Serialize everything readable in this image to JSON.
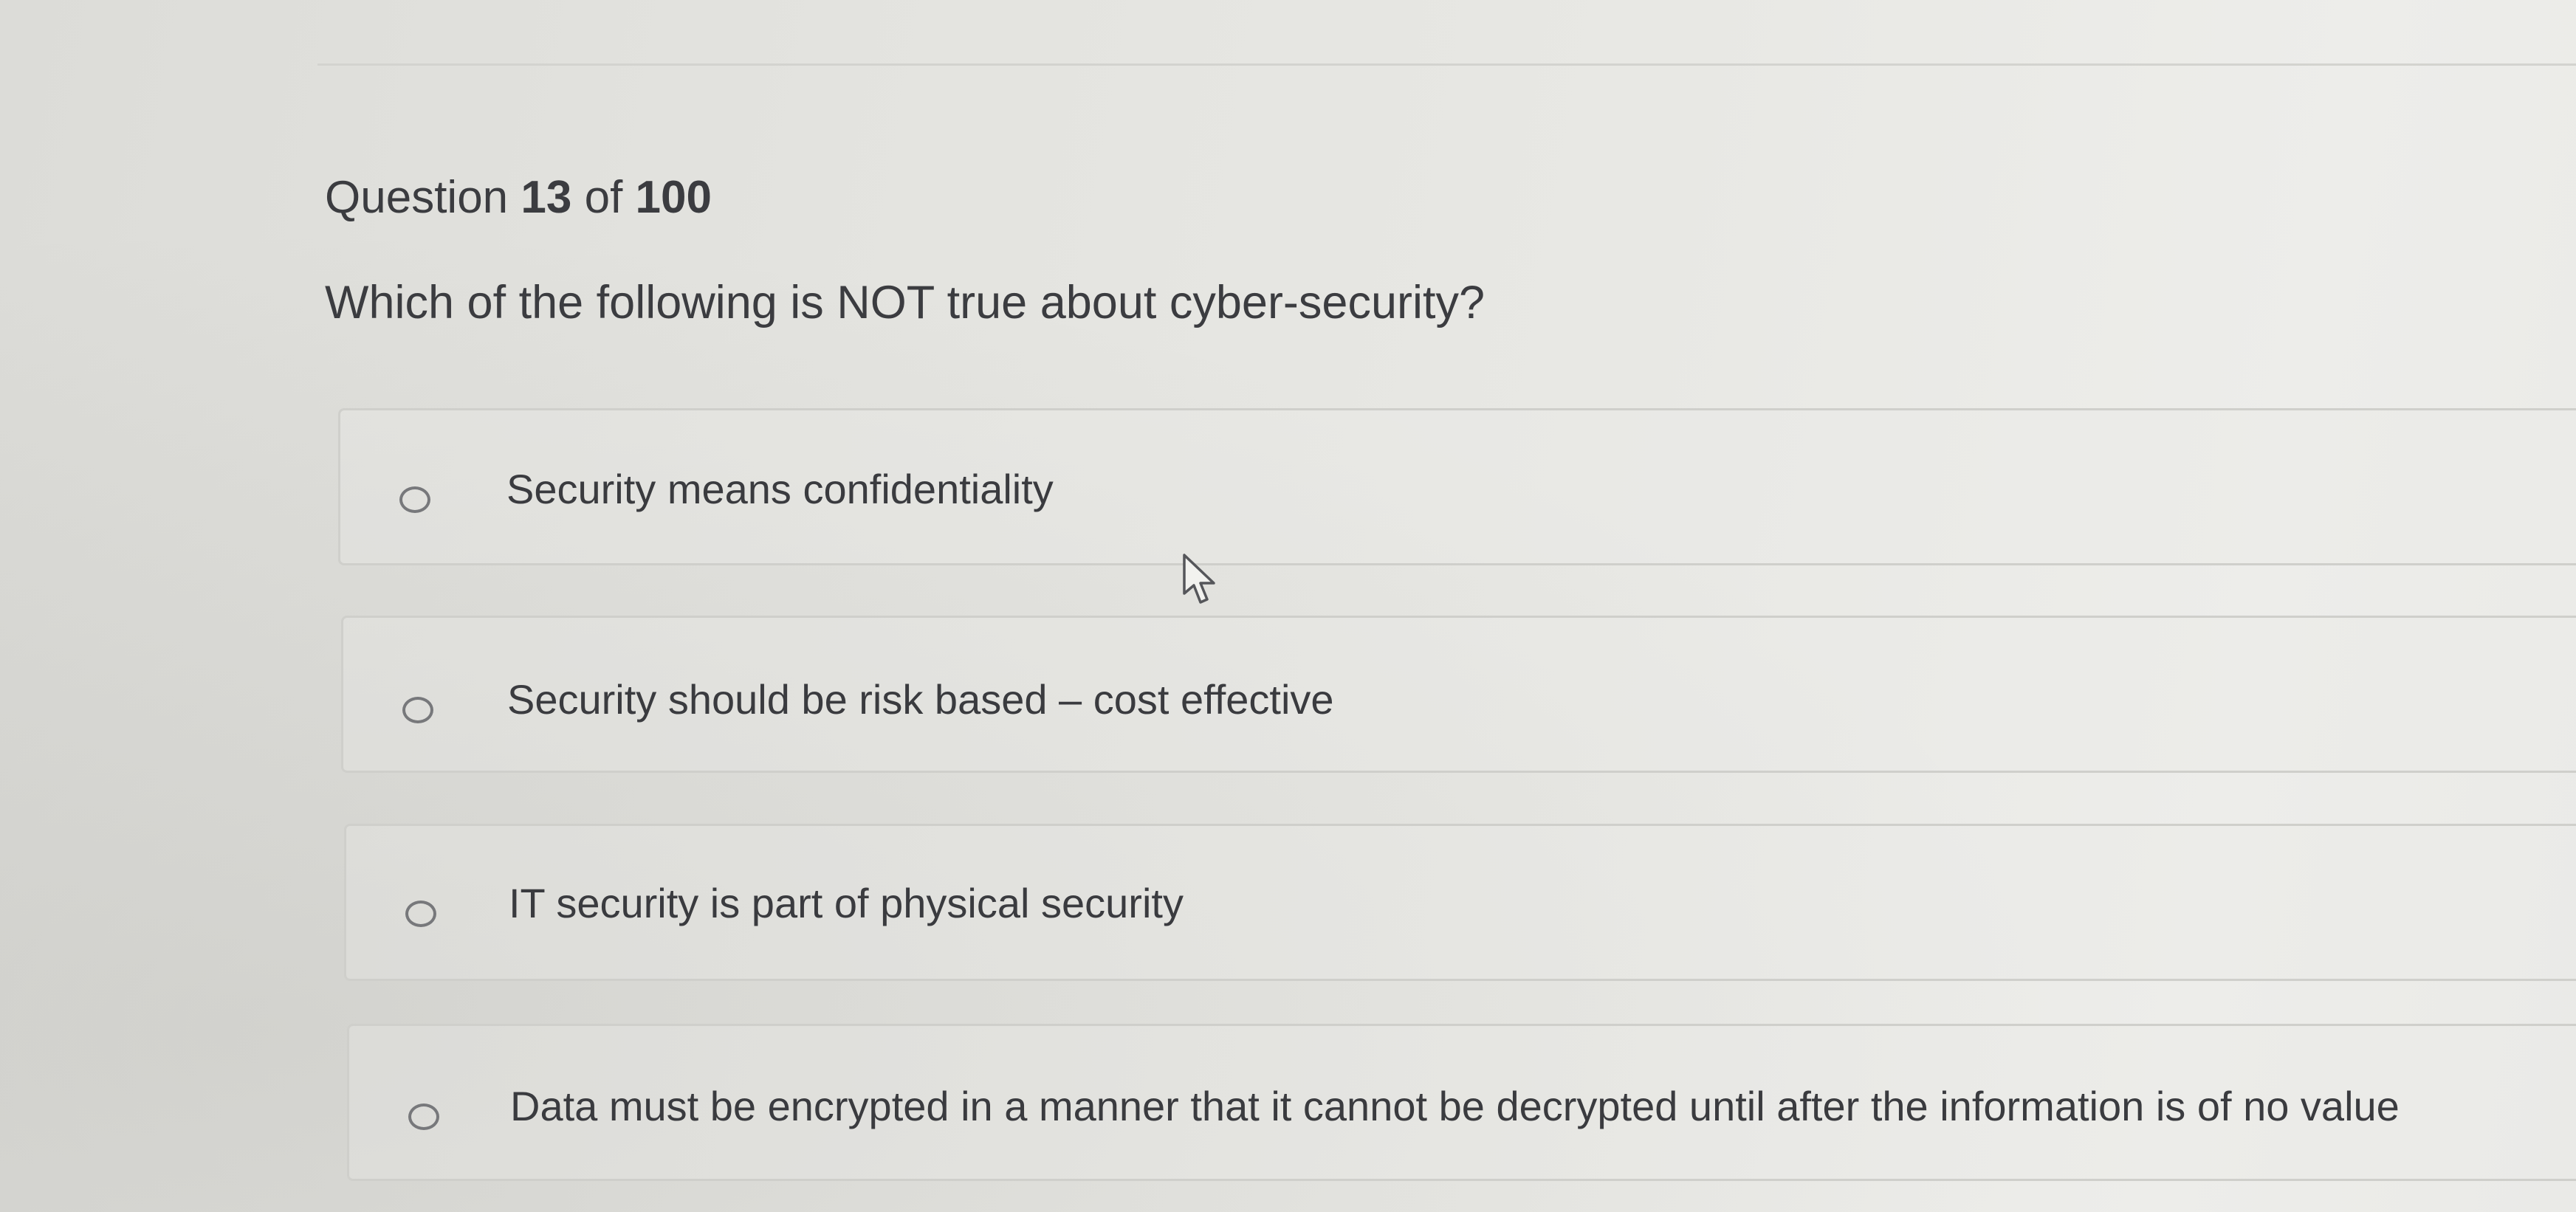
{
  "question": {
    "counter_prefix": "Question",
    "current": "13",
    "of_word": "of",
    "total": "100",
    "prompt": "Which of the following is NOT true about cyber-security?"
  },
  "options": [
    {
      "label": "Security means confidentiality",
      "selected": false
    },
    {
      "label": "Security should be risk based – cost effective",
      "selected": false
    },
    {
      "label": "IT security is part of physical security",
      "selected": false
    },
    {
      "label": "Data must be encrypted in a manner that it cannot be decrypted until after the information is of no value",
      "selected": false
    }
  ],
  "icons": {
    "radio": "radio-button-icon",
    "cursor": "mouse-pointer-icon"
  },
  "colors": {
    "text": "#3b3c40",
    "border": "#cfcfcb",
    "radio": "#77787b",
    "background": "#e3e3df"
  }
}
